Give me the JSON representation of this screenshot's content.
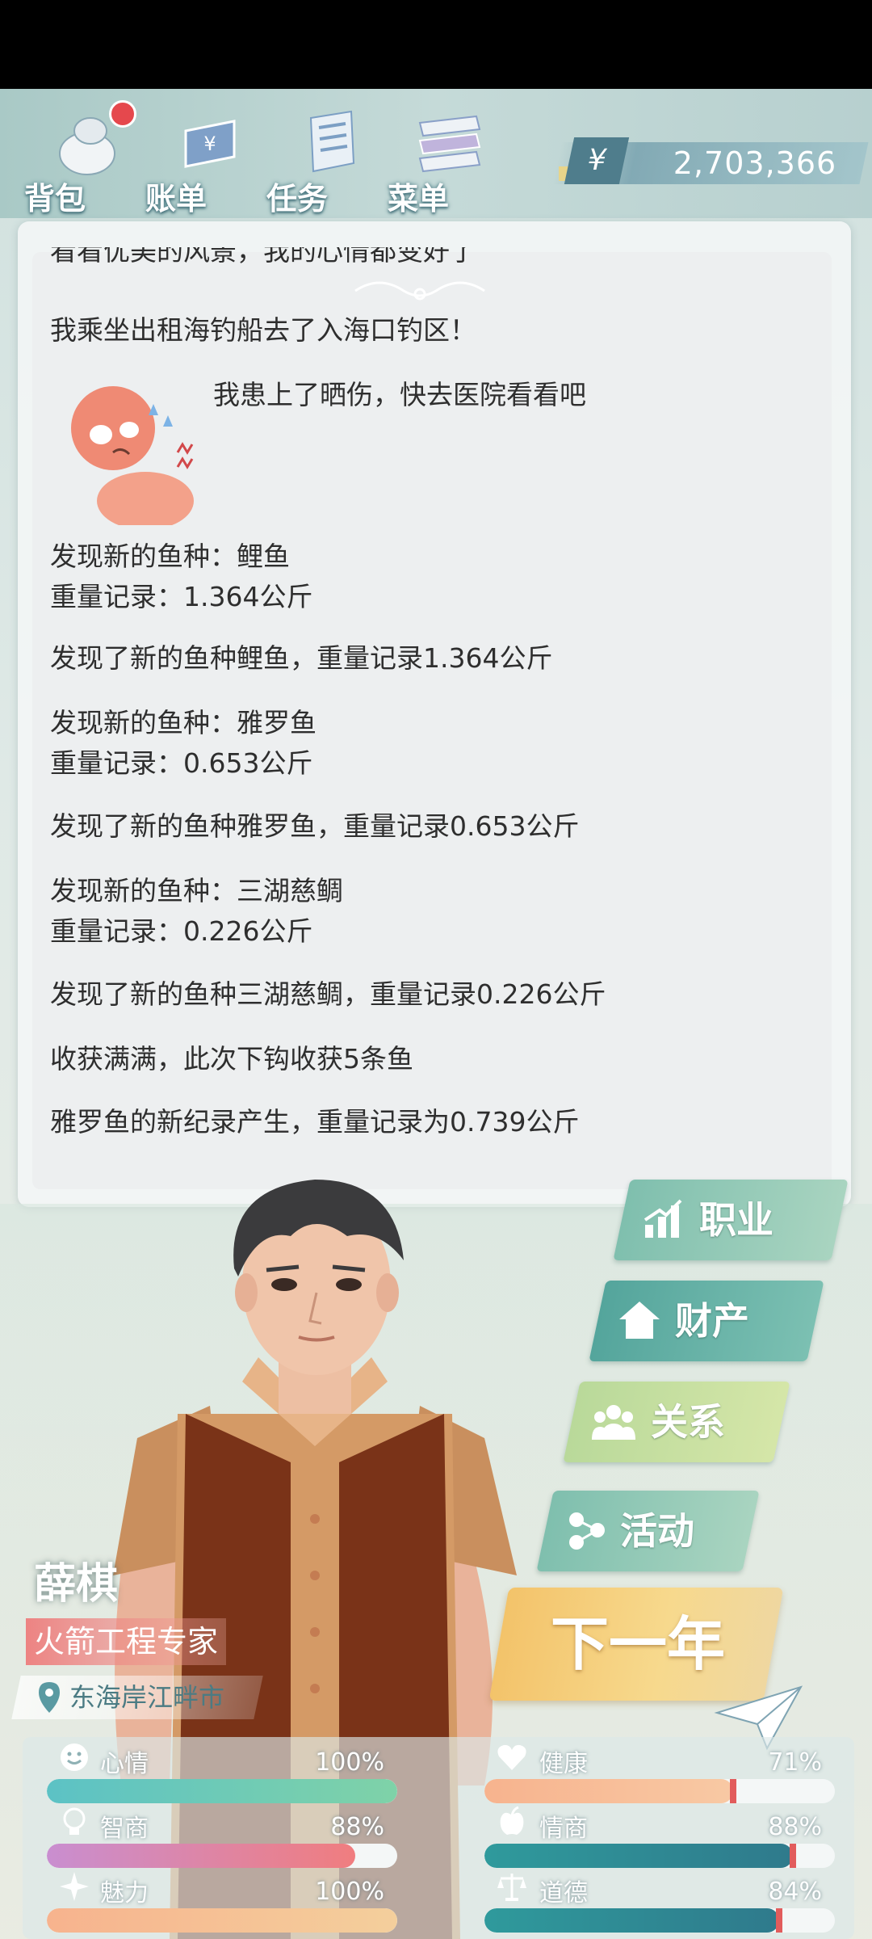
{
  "toolbar": {
    "items": [
      {
        "label": "背包",
        "icon": "backpack-icon"
      },
      {
        "label": "账单",
        "icon": "bill-icon"
      },
      {
        "label": "任务",
        "icon": "task-icon"
      },
      {
        "label": "菜单",
        "icon": "menu-icon"
      }
    ],
    "money_symbol": "¥",
    "money": "2,703,366"
  },
  "log": {
    "cut_line": "看看优美的风景，我的心情都变好了",
    "lines": [
      "我乘坐出租海钓船去了入海口钓区！",
      "我患上了晒伤，快去医院看看吧",
      "发现新的鱼种：鲤鱼",
      "重量记录：1.364公斤",
      "发现了新的鱼种鲤鱼，重量记录1.364公斤",
      "发现新的鱼种：雅罗鱼",
      "重量记录：0.653公斤",
      "发现了新的鱼种雅罗鱼，重量记录0.653公斤",
      "发现新的鱼种：三湖慈鲷",
      "重量记录：0.226公斤",
      "发现了新的鱼种三湖慈鲷，重量记录0.226公斤",
      "收获满满，此次下钩收获5条鱼",
      "雅罗鱼的新纪录产生，重量记录为0.739公斤"
    ]
  },
  "actions": {
    "career": "职业",
    "property": "财产",
    "relation": "关系",
    "activity": "活动",
    "next_year": "下一年"
  },
  "character": {
    "name": "薛棋",
    "job": "火箭工程专家",
    "location": "东海岸江畔市"
  },
  "stats": {
    "mood": {
      "label": "心情",
      "value": "100%",
      "level": 1.0
    },
    "health": {
      "label": "健康",
      "value": "71%",
      "level": 0.71
    },
    "iq": {
      "label": "智商",
      "value": "88%",
      "level": 0.88
    },
    "eq": {
      "label": "情商",
      "value": "88%",
      "level": 0.88
    },
    "charm": {
      "label": "魅力",
      "value": "100%",
      "level": 1.0
    },
    "morality": {
      "label": "道德",
      "value": "84%",
      "level": 0.84
    }
  }
}
